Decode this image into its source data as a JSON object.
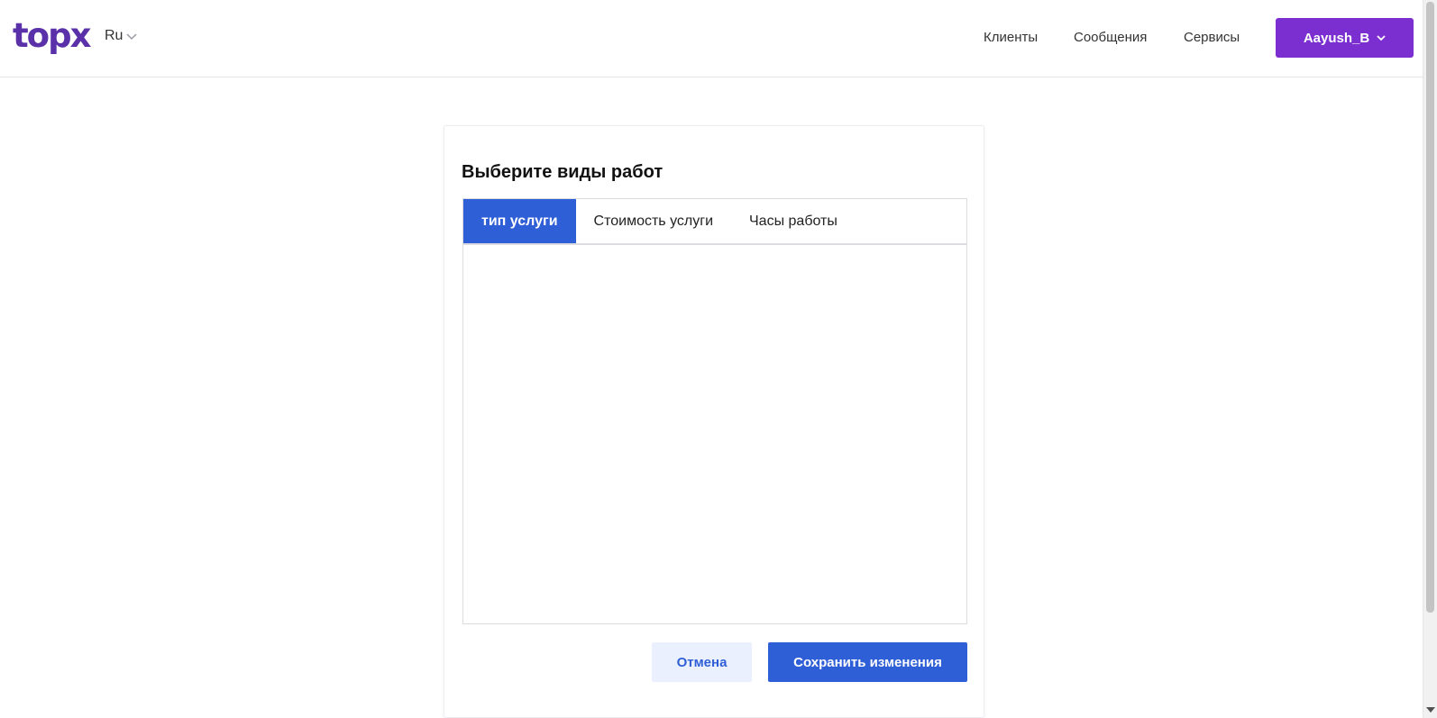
{
  "header": {
    "logo": "topx",
    "language": "Ru",
    "nav": [
      "Клиенты",
      "Сообщения",
      "Сервисы"
    ],
    "user": "Aayush_B"
  },
  "card": {
    "title": "Выберите виды работ",
    "tabs": [
      {
        "label": "тип услуги",
        "active": true
      },
      {
        "label": "Стоимость услуги",
        "active": false
      },
      {
        "label": "Часы работы",
        "active": false
      }
    ],
    "cancel_label": "Отмена",
    "save_label": "Сохранить изменения"
  },
  "colors": {
    "brand": "#5a31a8",
    "user_button": "#7c2fd0",
    "primary": "#2f5fd6",
    "cancel_bg": "#eaf0fd"
  },
  "icons": {
    "language_chevron": "chevron-down-icon",
    "user_chevron": "chevron-down-icon"
  }
}
